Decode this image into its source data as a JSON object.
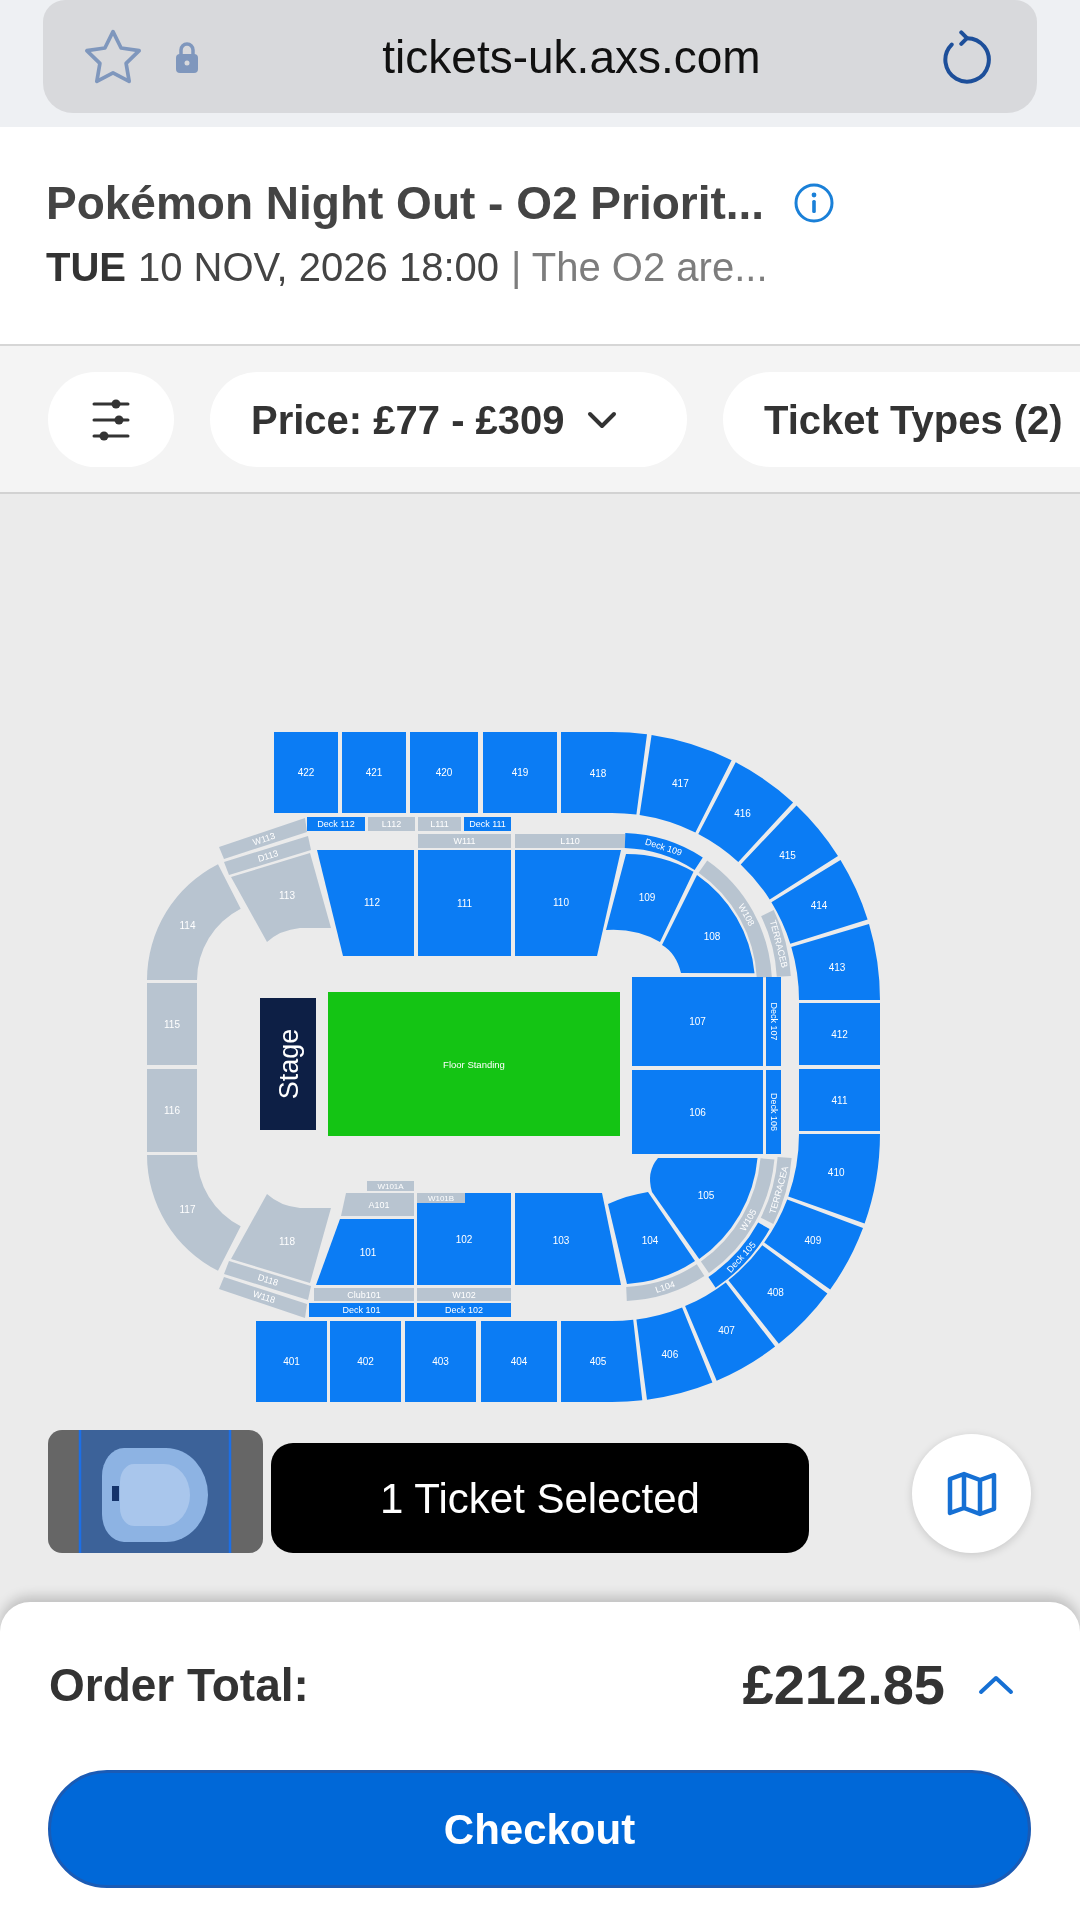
{
  "browser": {
    "url": "tickets-uk.axs.com"
  },
  "event": {
    "title": "Pokémon Night Out - O2 Priorit...",
    "day": "TUE",
    "datetime": "10 NOV, 2026 18:00",
    "venue": "| The O2 are..."
  },
  "filters": [
    {
      "kind": "icon"
    },
    {
      "kind": "dropdown",
      "label": "Price: £77 - £309"
    },
    {
      "kind": "button",
      "label": "Ticket Types (2)"
    }
  ],
  "map": {
    "stage": {
      "label": "Stage"
    },
    "sections": [
      {
        "label": "422",
        "available": true,
        "selected": false
      },
      {
        "label": "421",
        "available": true,
        "selected": false
      },
      {
        "label": "420",
        "available": true,
        "selected": false
      },
      {
        "label": "419",
        "available": true,
        "selected": false
      },
      {
        "label": "418",
        "available": true,
        "selected": false
      },
      {
        "label": "417",
        "available": true,
        "selected": false
      },
      {
        "label": "416",
        "available": true,
        "selected": false
      },
      {
        "label": "415",
        "available": true,
        "selected": false
      },
      {
        "label": "W113",
        "available": false,
        "selected": false
      },
      {
        "label": "Deck 112",
        "available": true,
        "selected": false
      },
      {
        "label": "L112",
        "available": false,
        "selected": false
      },
      {
        "label": "L111",
        "available": false,
        "selected": false
      },
      {
        "label": "Deck 111",
        "available": true,
        "selected": false
      },
      {
        "label": "D113",
        "available": false,
        "selected": false
      },
      {
        "label": "W111",
        "available": false,
        "selected": false
      },
      {
        "label": "L110",
        "available": false,
        "selected": false
      },
      {
        "label": "Deck 109",
        "available": true,
        "selected": false
      },
      {
        "label": "112",
        "available": true,
        "selected": false
      },
      {
        "label": "111",
        "available": true,
        "selected": false
      },
      {
        "label": "110",
        "available": true,
        "selected": false
      },
      {
        "label": "113",
        "available": false,
        "selected": false
      },
      {
        "label": "109",
        "available": true,
        "selected": false
      },
      {
        "label": "114",
        "available": false,
        "selected": false
      },
      {
        "label": "W108",
        "available": false,
        "selected": false
      },
      {
        "label": "414",
        "available": true,
        "selected": false
      },
      {
        "label": "108",
        "available": true,
        "selected": false
      },
      {
        "label": "TERRACEB",
        "available": false,
        "selected": false
      },
      {
        "label": "413",
        "available": true,
        "selected": false
      },
      {
        "label": "107",
        "available": true,
        "selected": false
      },
      {
        "label": "Deck 107",
        "available": true,
        "selected": false
      },
      {
        "label": "115",
        "available": false,
        "selected": false
      },
      {
        "label": "Floor Standing",
        "available": true,
        "selected": true
      },
      {
        "label": "412",
        "available": true,
        "selected": false
      },
      {
        "label": "116",
        "available": false,
        "selected": false
      },
      {
        "label": "106",
        "available": true,
        "selected": false
      },
      {
        "label": "Deck 106",
        "available": true,
        "selected": false
      },
      {
        "label": "411",
        "available": true,
        "selected": false
      },
      {
        "label": "410",
        "available": true,
        "selected": false
      },
      {
        "label": "117",
        "available": false,
        "selected": false
      },
      {
        "label": "105",
        "available": true,
        "selected": false
      },
      {
        "label": "W105",
        "available": false,
        "selected": false
      },
      {
        "label": "TERRACEA",
        "available": false,
        "selected": false
      },
      {
        "label": "W101A",
        "available": false,
        "selected": false
      },
      {
        "label": "118",
        "available": false,
        "selected": false
      },
      {
        "label": "A101",
        "available": false,
        "selected": false
      },
      {
        "label": "102",
        "available": true,
        "selected": false
      },
      {
        "label": "W101B",
        "available": false,
        "selected": false
      },
      {
        "label": "103",
        "available": true,
        "selected": false
      },
      {
        "label": "104",
        "available": true,
        "selected": false
      },
      {
        "label": "409",
        "available": true,
        "selected": false
      },
      {
        "label": "101",
        "available": true,
        "selected": false
      },
      {
        "label": "Deck 105",
        "available": true,
        "selected": false
      },
      {
        "label": "408",
        "available": true,
        "selected": false
      },
      {
        "label": "D118",
        "available": false,
        "selected": false
      },
      {
        "label": "L104",
        "available": false,
        "selected": false
      },
      {
        "label": "W118",
        "available": false,
        "selected": false
      },
      {
        "label": "407",
        "available": true,
        "selected": false
      },
      {
        "label": "Club101",
        "available": false,
        "selected": false
      },
      {
        "label": "W102",
        "available": false,
        "selected": false
      },
      {
        "label": "Deck 101",
        "available": true,
        "selected": false
      },
      {
        "label": "Deck 102",
        "available": true,
        "selected": false
      },
      {
        "label": "406",
        "available": true,
        "selected": false
      },
      {
        "label": "401",
        "available": true,
        "selected": false
      },
      {
        "label": "402",
        "available": true,
        "selected": false
      },
      {
        "label": "403",
        "available": true,
        "selected": false
      },
      {
        "label": "404",
        "available": true,
        "selected": false
      },
      {
        "label": "405",
        "available": true,
        "selected": false
      }
    ]
  },
  "selection": {
    "label": "1 Ticket Selected"
  },
  "order": {
    "label": "Order Total:",
    "total": "£212.85",
    "expanded": false
  },
  "checkout": {
    "label": "Checkout"
  }
}
